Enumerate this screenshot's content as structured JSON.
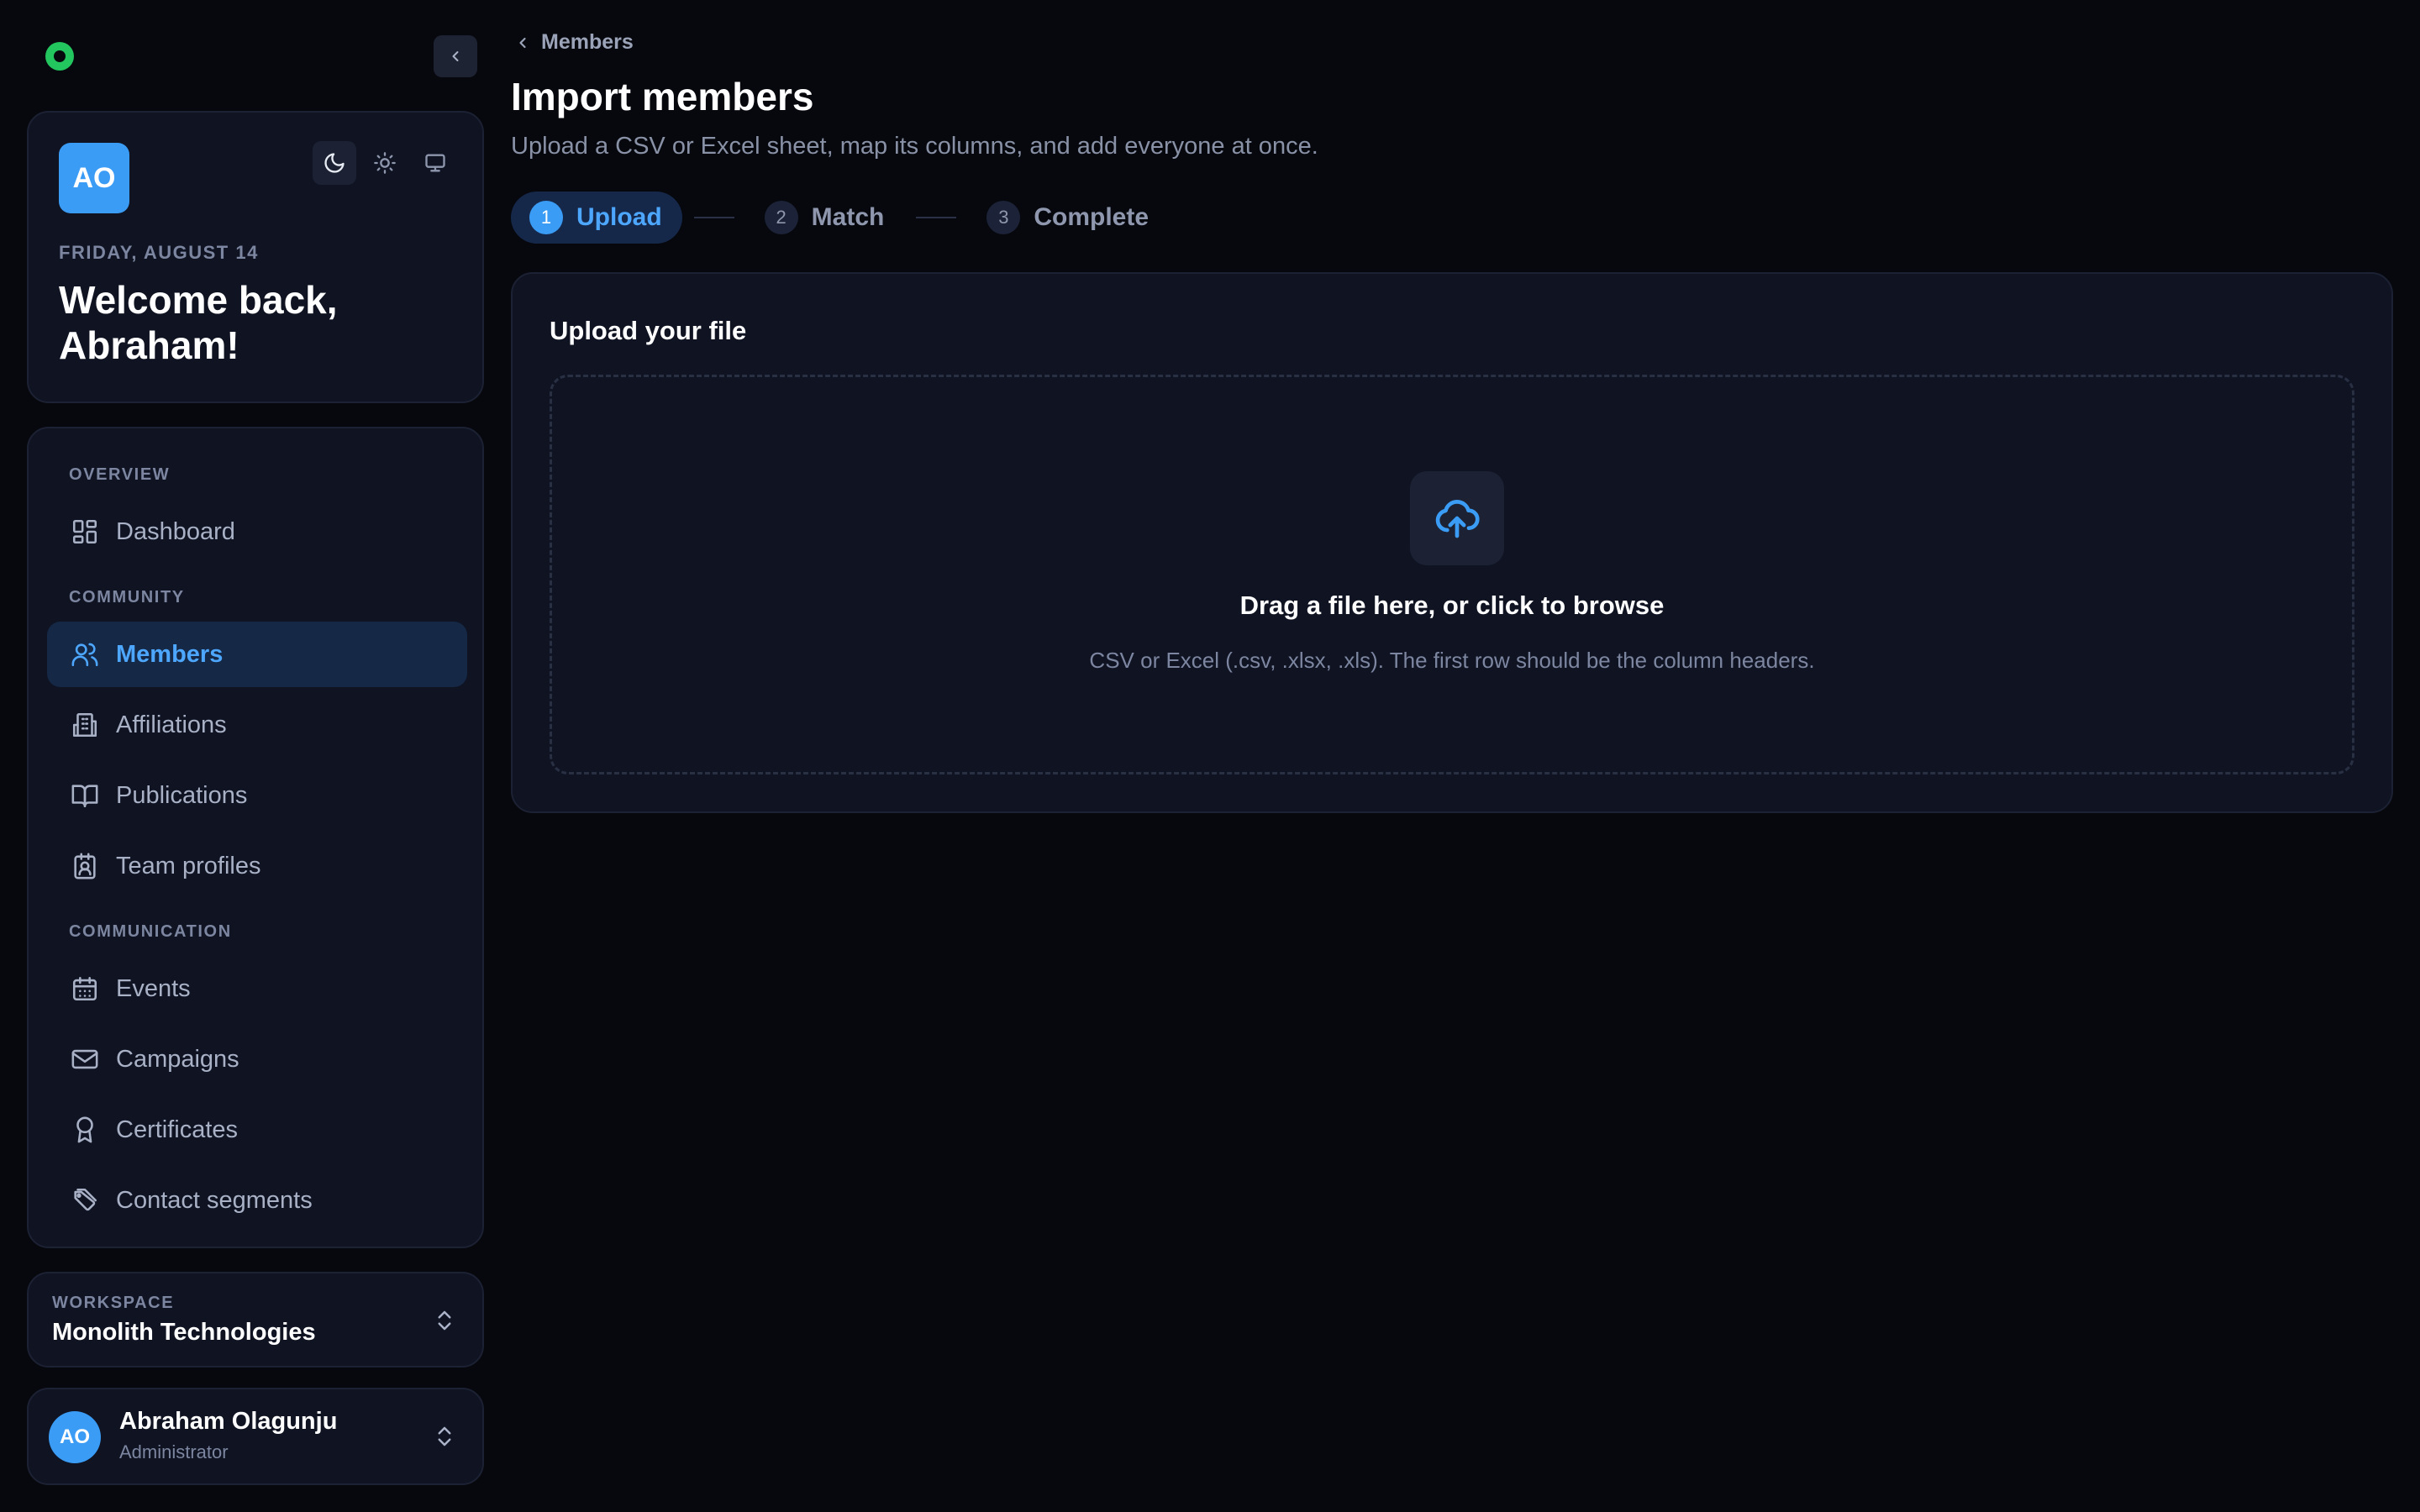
{
  "sidebar": {
    "welcome": {
      "avatar_initials": "AO",
      "date": "FRIDAY, AUGUST 14",
      "greeting": "Welcome back, Abraham!",
      "theme_options": [
        "moon-icon",
        "sun-icon",
        "monitor-icon"
      ]
    },
    "sections": [
      {
        "label": "OVERVIEW",
        "items": [
          {
            "label": "Dashboard",
            "icon": "dashboard-icon"
          }
        ]
      },
      {
        "label": "COMMUNITY",
        "items": [
          {
            "label": "Members",
            "icon": "users-icon",
            "active": true
          },
          {
            "label": "Affiliations",
            "icon": "building-icon"
          },
          {
            "label": "Publications",
            "icon": "book-icon"
          },
          {
            "label": "Team profiles",
            "icon": "id-badge-icon"
          }
        ]
      },
      {
        "label": "COMMUNICATION",
        "items": [
          {
            "label": "Events",
            "icon": "calendar-icon"
          },
          {
            "label": "Campaigns",
            "icon": "mail-icon"
          },
          {
            "label": "Certificates",
            "icon": "award-icon"
          },
          {
            "label": "Contact segments",
            "icon": "tags-icon"
          }
        ]
      }
    ],
    "workspace": {
      "label": "WORKSPACE",
      "name": "Monolith Technologies"
    },
    "user": {
      "initials": "AO",
      "name": "Abraham Olagunju",
      "role": "Administrator"
    }
  },
  "main": {
    "breadcrumb": "Members",
    "title": "Import members",
    "subtitle": "Upload a CSV or Excel sheet, map its columns, and add everyone at once.",
    "steps": [
      {
        "num": "1",
        "label": "Upload",
        "active": true
      },
      {
        "num": "2",
        "label": "Match"
      },
      {
        "num": "3",
        "label": "Complete"
      }
    ],
    "upload": {
      "title": "Upload your file",
      "drop_title": "Drag a file here, or click to browse",
      "drop_hint": "CSV or Excel (.csv, .xlsx, .xls). The first row should be the column headers."
    }
  },
  "colors": {
    "accent": "#3b9cf5",
    "active_bg": "#152846",
    "brand_dot": "#22c55e",
    "background": "#07080d"
  }
}
